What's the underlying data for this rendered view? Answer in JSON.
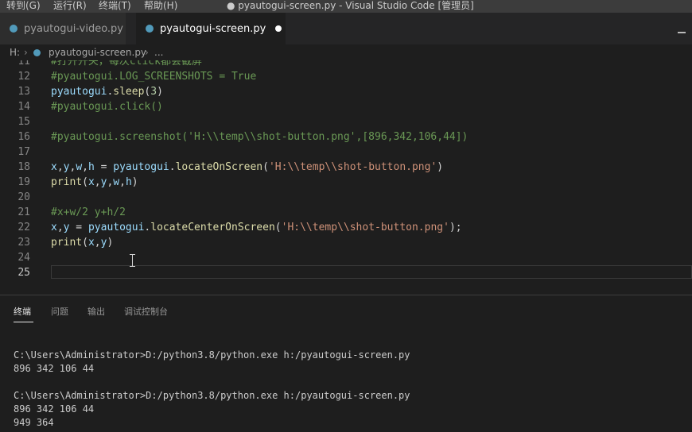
{
  "menubar": {
    "items": [
      "转到(G)",
      "运行(R)",
      "终端(T)",
      "帮助(H)"
    ],
    "window_title": "● pyautogui-screen.py - Visual Studio Code [管理员]"
  },
  "tabs": [
    {
      "label": "pyautogui-video.py",
      "icon": "python-icon",
      "active": false
    },
    {
      "label": "pyautogui-screen.py",
      "icon": "python-icon",
      "active": true,
      "dirty": true
    }
  ],
  "breadcrumb": [
    "H:",
    "pyautogui-screen.py",
    "..."
  ],
  "editor": {
    "current_line": 25,
    "lines": [
      {
        "n": "11",
        "tokens": [
          {
            "t": "#打开开关，每次click都会截屏",
            "c": "comment"
          }
        ]
      },
      {
        "n": "12",
        "tokens": [
          {
            "t": "#pyautogui.LOG_SCREENSHOTS = True",
            "c": "comment"
          }
        ]
      },
      {
        "n": "13",
        "tokens": [
          {
            "t": "pyautogui",
            "c": "var"
          },
          {
            "t": ".",
            "c": "punc"
          },
          {
            "t": "sleep",
            "c": "fn"
          },
          {
            "t": "(",
            "c": "punc"
          },
          {
            "t": "3",
            "c": "num"
          },
          {
            "t": ")",
            "c": "punc"
          }
        ]
      },
      {
        "n": "14",
        "tokens": [
          {
            "t": "#pyautogui.click()",
            "c": "comment"
          }
        ]
      },
      {
        "n": "15",
        "tokens": []
      },
      {
        "n": "16",
        "tokens": [
          {
            "t": "#pyautogui.screenshot('H:\\\\temp\\\\shot-button.png',[896,342,106,44])",
            "c": "comment"
          }
        ]
      },
      {
        "n": "17",
        "tokens": []
      },
      {
        "n": "18",
        "tokens": [
          {
            "t": "x",
            "c": "var"
          },
          {
            "t": ",",
            "c": "punc"
          },
          {
            "t": "y",
            "c": "var"
          },
          {
            "t": ",",
            "c": "punc"
          },
          {
            "t": "w",
            "c": "var"
          },
          {
            "t": ",",
            "c": "punc"
          },
          {
            "t": "h",
            "c": "var"
          },
          {
            "t": " = ",
            "c": "punc"
          },
          {
            "t": "pyautogui",
            "c": "var"
          },
          {
            "t": ".",
            "c": "punc"
          },
          {
            "t": "locateOnScreen",
            "c": "fn"
          },
          {
            "t": "(",
            "c": "punc"
          },
          {
            "t": "'H:\\\\temp\\\\shot-button.png'",
            "c": "str"
          },
          {
            "t": ")",
            "c": "punc"
          }
        ]
      },
      {
        "n": "19",
        "tokens": [
          {
            "t": "print",
            "c": "fn"
          },
          {
            "t": "(",
            "c": "punc"
          },
          {
            "t": "x",
            "c": "var"
          },
          {
            "t": ",",
            "c": "punc"
          },
          {
            "t": "y",
            "c": "var"
          },
          {
            "t": ",",
            "c": "punc"
          },
          {
            "t": "w",
            "c": "var"
          },
          {
            "t": ",",
            "c": "punc"
          },
          {
            "t": "h",
            "c": "var"
          },
          {
            "t": ")",
            "c": "punc"
          }
        ]
      },
      {
        "n": "20",
        "tokens": []
      },
      {
        "n": "21",
        "tokens": [
          {
            "t": "#x+w/2 y+h/2",
            "c": "comment"
          }
        ]
      },
      {
        "n": "22",
        "tokens": [
          {
            "t": "x",
            "c": "var"
          },
          {
            "t": ",",
            "c": "punc"
          },
          {
            "t": "y",
            "c": "var"
          },
          {
            "t": " = ",
            "c": "punc"
          },
          {
            "t": "pyautogui",
            "c": "var"
          },
          {
            "t": ".",
            "c": "punc"
          },
          {
            "t": "locateCenterOnScreen",
            "c": "fn"
          },
          {
            "t": "(",
            "c": "punc"
          },
          {
            "t": "'H:\\\\temp\\\\shot-button.png'",
            "c": "str"
          },
          {
            "t": ");",
            "c": "punc"
          }
        ]
      },
      {
        "n": "23",
        "tokens": [
          {
            "t": "print",
            "c": "fn"
          },
          {
            "t": "(",
            "c": "punc"
          },
          {
            "t": "x",
            "c": "var"
          },
          {
            "t": ",",
            "c": "punc"
          },
          {
            "t": "y",
            "c": "var"
          },
          {
            "t": ")",
            "c": "punc"
          }
        ]
      },
      {
        "n": "24",
        "tokens": []
      },
      {
        "n": "25",
        "tokens": []
      }
    ]
  },
  "panel": {
    "tabs": [
      "终端",
      "问题",
      "输出",
      "调试控制台"
    ],
    "active_tab": "终端",
    "terminal_lines": [
      "C:\\Users\\Administrator>D:/python3.8/python.exe h:/pyautogui-screen.py",
      "896 342 106 44",
      "",
      "C:\\Users\\Administrator>D:/python3.8/python.exe h:/pyautogui-screen.py",
      "896 342 106 44",
      "949 364"
    ]
  },
  "colors": {
    "comment": "#6a9955",
    "variable": "#9cdcfe",
    "function": "#dcdcaa",
    "number": "#b5cea8",
    "string": "#ce9178",
    "python_icon": "#519aba"
  }
}
